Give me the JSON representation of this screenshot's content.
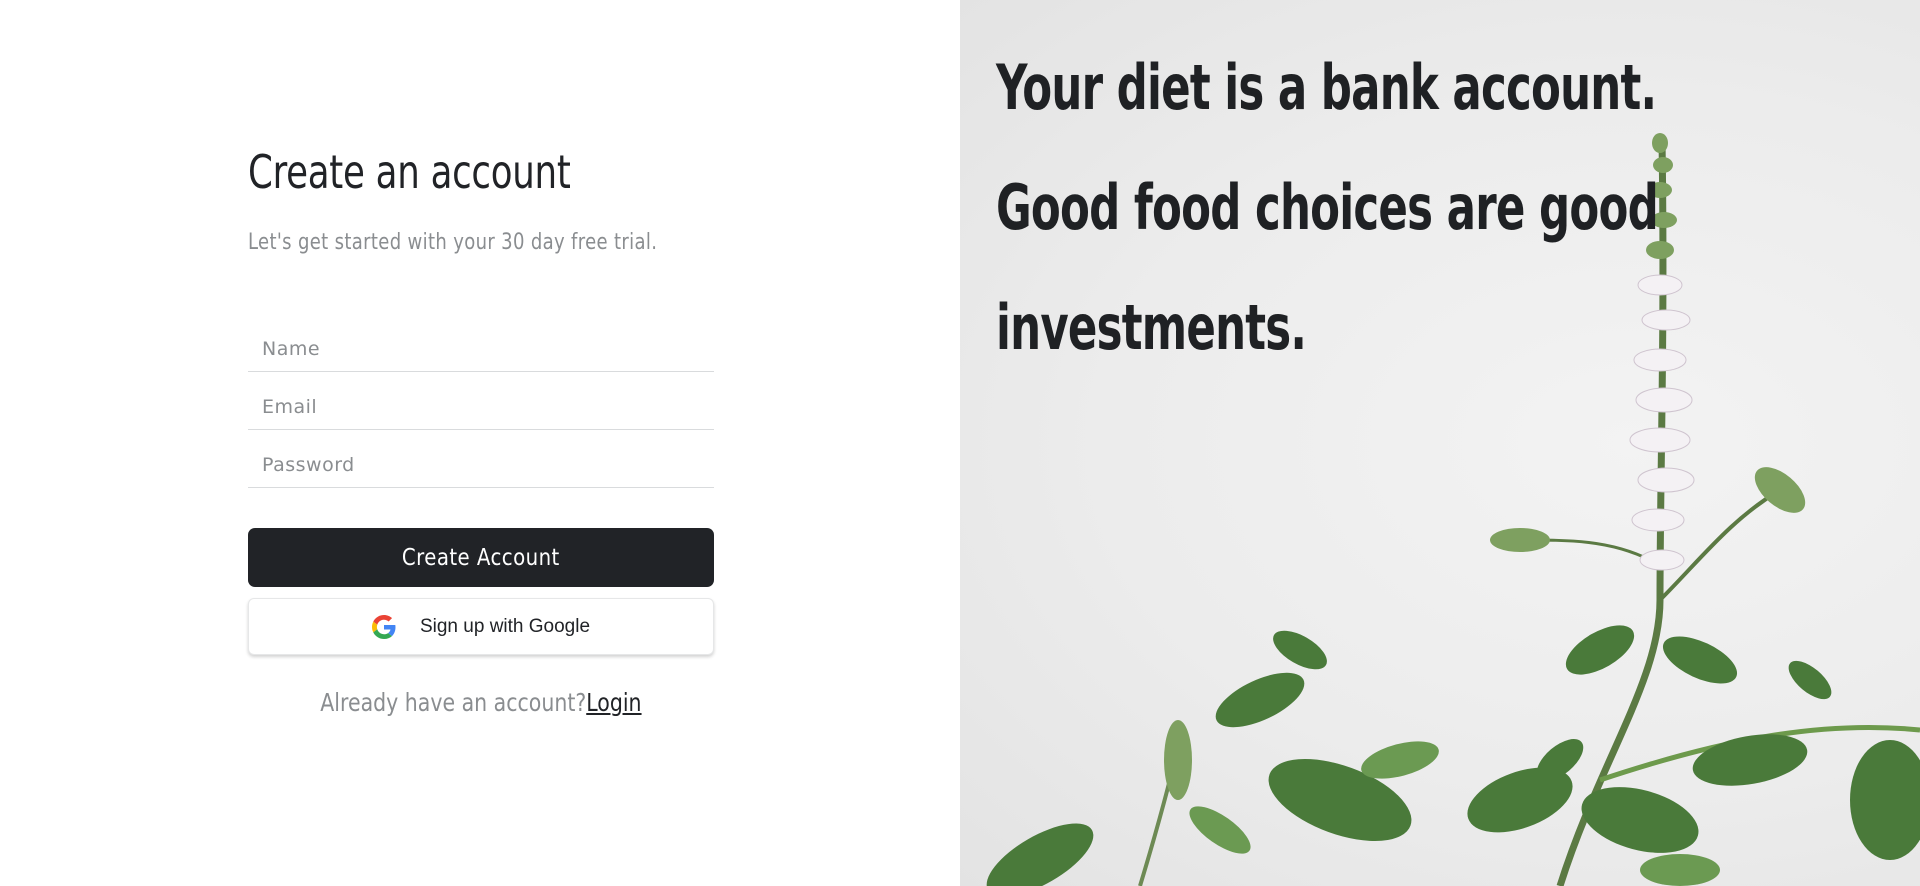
{
  "form": {
    "title": "Create an account",
    "subtitle": "Let's get started with your 30 day free trial.",
    "fields": {
      "name_placeholder": "Name",
      "email_placeholder": "Email",
      "password_placeholder": "Password"
    },
    "create_button_label": "Create Account",
    "google_button_label": "Sign up with Google",
    "login_prompt": "Already have an account?",
    "login_link_label": "Login"
  },
  "hero": {
    "quote_lines": [
      "Your diet is a bank account.",
      "Good food choices are good",
      "investments."
    ],
    "image": "flowering-mint-plant-photo"
  },
  "colors": {
    "primary_dark": "#212327",
    "muted_text": "#8a8d90",
    "hero_background": "#ececec",
    "leaf_green": "#4a7a3a"
  }
}
